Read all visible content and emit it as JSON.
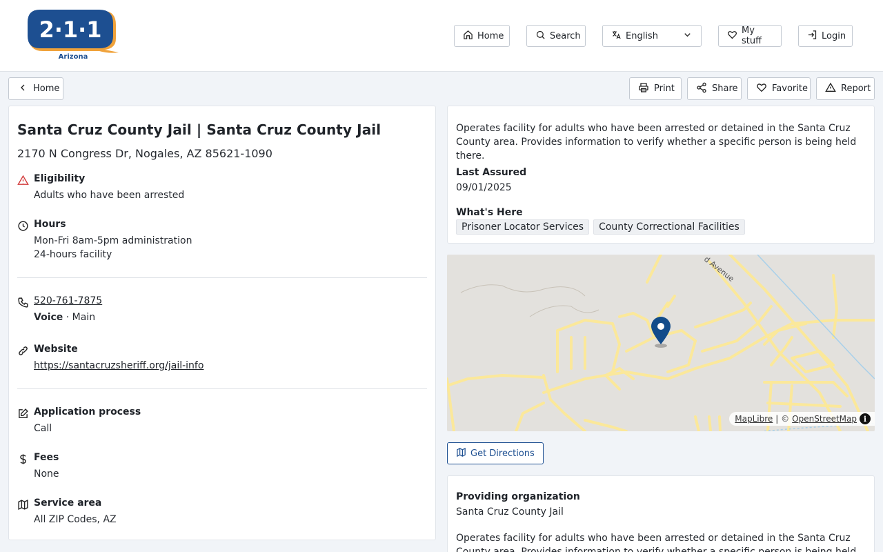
{
  "logo": {
    "number_text": "2·1·1",
    "caption": "Arizona"
  },
  "nav": {
    "home": "Home",
    "search": "Search",
    "language": "English",
    "mystuff": "My stuff",
    "login": "Login"
  },
  "actions": {
    "back": "Home",
    "print": "Print",
    "share": "Share",
    "favorite": "Favorite",
    "report": "Report"
  },
  "service": {
    "title": "Santa Cruz County Jail | Santa Cruz County Jail",
    "address": "2170 N Congress Dr, Nogales, AZ 85621-1090",
    "eligibility_label": "Eligibility",
    "eligibility_value": "Adults who have been arrested",
    "hours_label": "Hours",
    "hours_line1": "Mon-Fri 8am-5pm administration",
    "hours_line2": "24-hours facility",
    "phone": "520-761-7875",
    "phone_type": "Voice",
    "phone_sep": " · ",
    "phone_desc": "Main",
    "website_label": "Website",
    "website_url": "https://santacruzsheriff.org/jail-info",
    "application_label": "Application process",
    "application_value": "Call",
    "fees_label": "Fees",
    "fees_value": "None",
    "area_label": "Service area",
    "area_value": "All ZIP Codes, AZ"
  },
  "details": {
    "description": "Operates facility for adults who have been arrested or detained in the Santa Cruz County area. Provides information to verify whether a specific person is being held there.",
    "last_assured_label": "Last Assured",
    "last_assured_value": "09/01/2025",
    "whats_here_label": "What's Here",
    "tags": [
      "Prisoner Locator Services",
      "County Correctional Facilities"
    ]
  },
  "map": {
    "street": "d Avenue",
    "attribution_maplibre": "MapLibre",
    "attribution_sep": " | © ",
    "attribution_osm": "OpenStreetMap",
    "info": "i",
    "road_color": "#fbe89a",
    "pin_color": "#124c8a"
  },
  "directions_label": "Get Directions",
  "organization": {
    "label": "Providing organization",
    "name": "Santa Cruz County Jail",
    "description": "Operates facility for adults who have been arrested or detained in the Santa Cruz County area. Provides information to verify whether a specific person is being held there."
  }
}
